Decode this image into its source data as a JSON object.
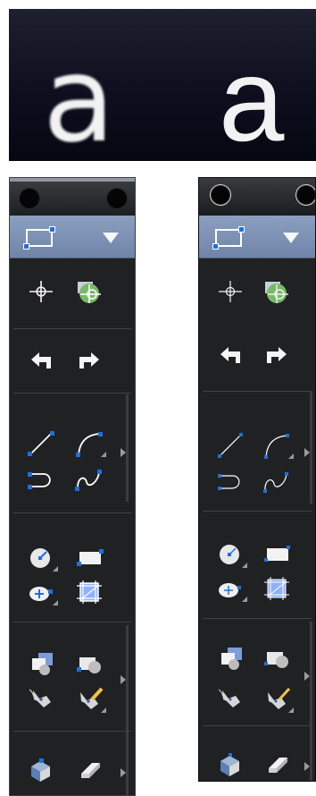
{
  "comparison": {
    "left_glyph": "a",
    "right_glyph": "a"
  },
  "colors": {
    "palette_bg": "#202123",
    "selector_blue": "#7c91b4",
    "accent_blue": "#1f6fe0",
    "icon_white": "#f5f5f5"
  },
  "icons": [
    "crosshair-icon",
    "shape-target-icon",
    "undo-arrow-icon",
    "redo-arrow-icon",
    "line-icon",
    "arc-icon",
    "curve-hook-icon",
    "spline-icon",
    "circle-icon",
    "rectangle-icon",
    "ellipse-add-icon",
    "hatch-grid-icon",
    "copy-shape-icon",
    "subtract-shape-icon",
    "tag-icon",
    "tag-edit-icon",
    "extrude-icon",
    "eraser-icon"
  ]
}
